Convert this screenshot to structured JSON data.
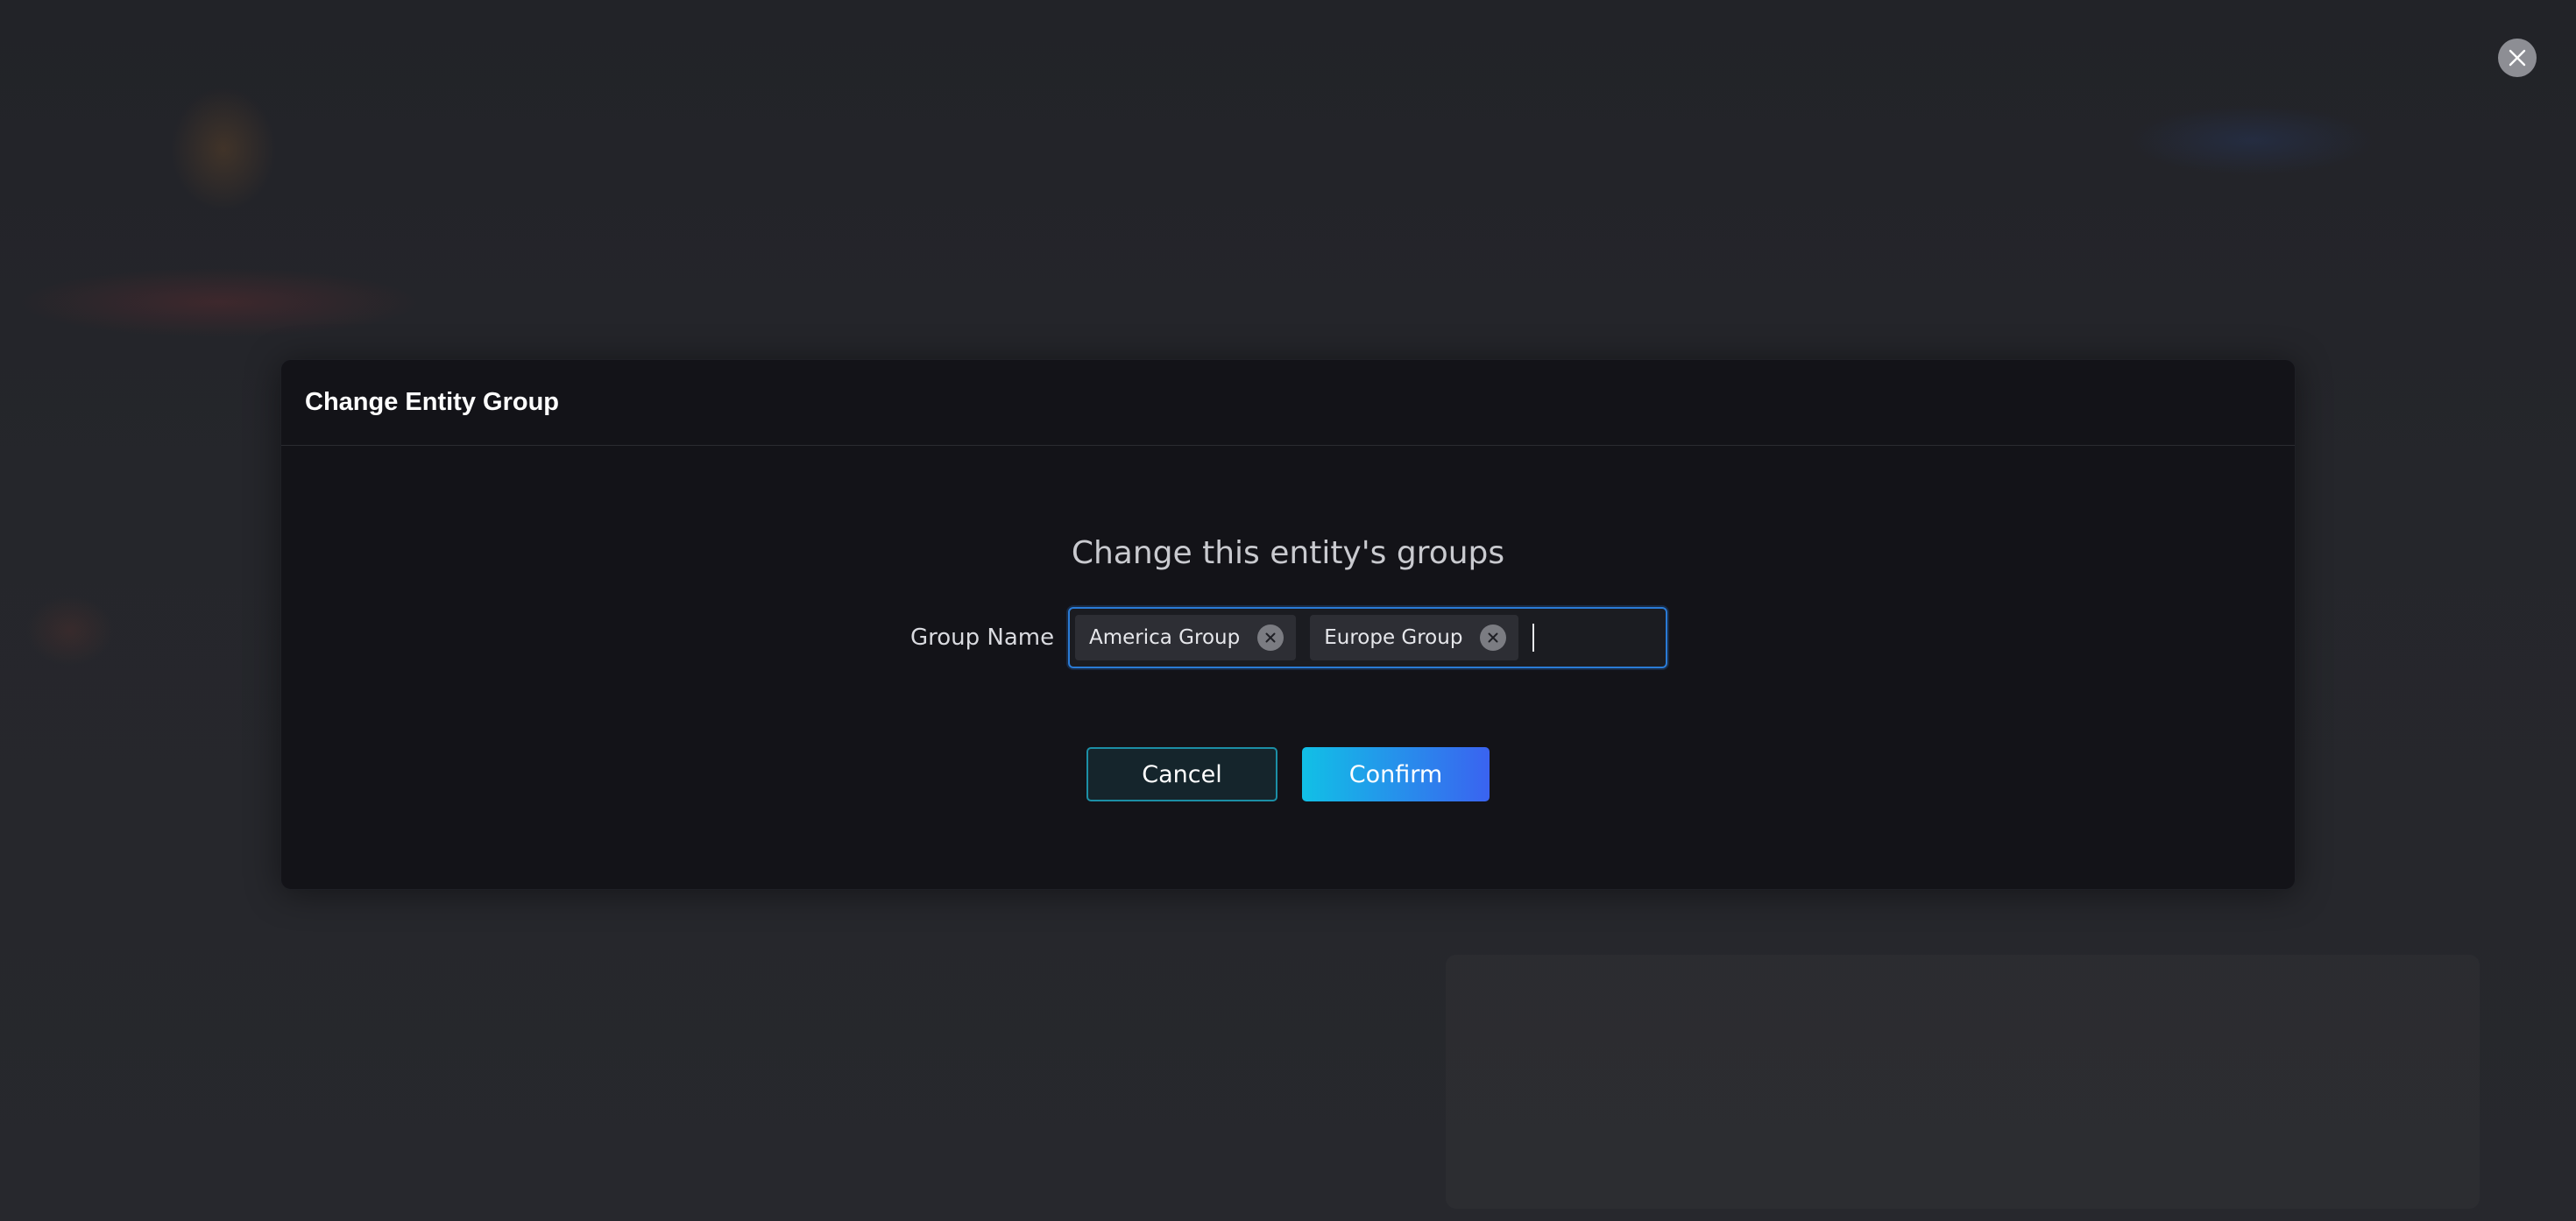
{
  "dialog": {
    "title": "Change Entity Group",
    "subtitle": "Change this entity's groups",
    "field_label": "Group Name",
    "chips": [
      {
        "label": "America Group"
      },
      {
        "label": "Europe Group"
      }
    ],
    "input_value": "",
    "cancel_label": "Cancel",
    "confirm_label": "Confirm"
  },
  "icons": {
    "overlay_close": "close-icon",
    "chip_remove": "close-circle-icon"
  },
  "colors": {
    "modal_background": "#131318",
    "input_focus_border": "#2a7bd6",
    "cancel_border": "#1c8fa6",
    "confirm_gradient_start": "#11c0e6",
    "confirm_gradient_end": "#3a63f0"
  }
}
